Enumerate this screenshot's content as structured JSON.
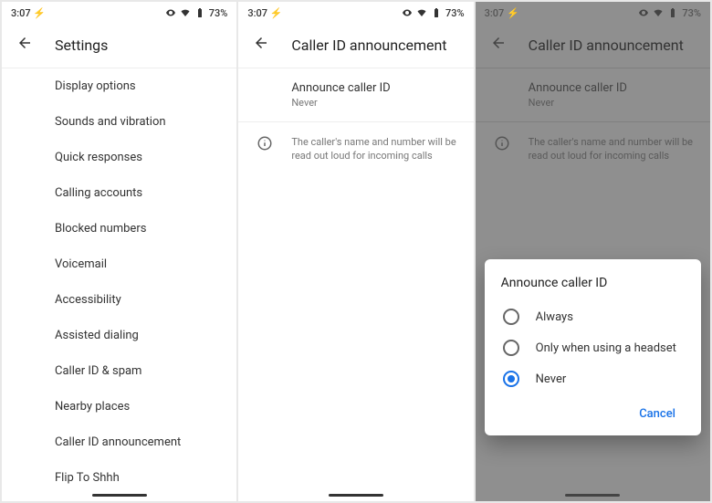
{
  "status": {
    "time": "3:07",
    "battery_pct": "73%"
  },
  "screen1": {
    "header_title": "Settings",
    "items": [
      "Display options",
      "Sounds and vibration",
      "Quick responses",
      "Calling accounts",
      "Blocked numbers",
      "Voicemail",
      "Accessibility",
      "Assisted dialing",
      "Caller ID & spam",
      "Nearby places",
      "Caller ID announcement",
      "Flip To Shhh"
    ]
  },
  "screen2": {
    "header_title": "Caller ID announcement",
    "pref_title": "Announce caller ID",
    "pref_value": "Never",
    "info_text": "The caller's name and number will be read out loud for incoming calls"
  },
  "screen3": {
    "header_title": "Caller ID announcement",
    "pref_title": "Announce caller ID",
    "pref_value": "Never",
    "info_text": "The caller's name and number will be read out loud for incoming calls",
    "dialog": {
      "title": "Announce caller ID",
      "options": [
        "Always",
        "Only when using a headset",
        "Never"
      ],
      "selected_index": 2,
      "cancel": "Cancel"
    }
  }
}
